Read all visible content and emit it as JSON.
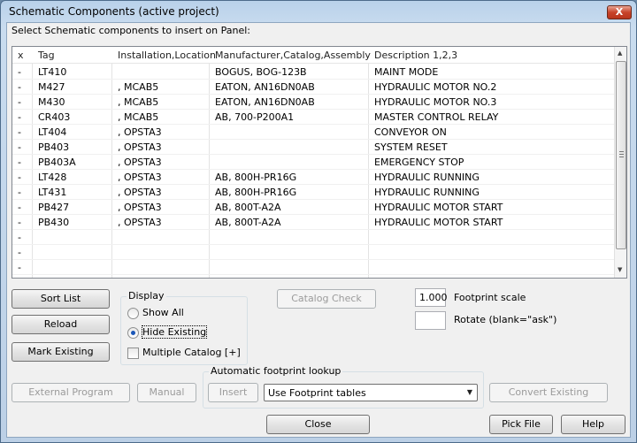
{
  "window": {
    "title": "Schematic Components (active project)",
    "close_glyph": "X"
  },
  "prompt": "Select Schematic components to insert on Panel:",
  "table": {
    "headers": [
      "x",
      "Tag",
      "Installation,Location",
      "Manufacturer,Catalog,Assembly",
      "Description 1,2,3"
    ],
    "rows": [
      {
        "x": "-",
        "tag": "LT410",
        "loc": "",
        "mfr": "BOGUS, BOG-123B",
        "desc": "MAINT MODE"
      },
      {
        "x": "-",
        "tag": "M427",
        "loc": ", MCAB5",
        "mfr": "EATON, AN16DN0AB",
        "desc": "HYDRAULIC MOTOR NO.2"
      },
      {
        "x": "-",
        "tag": "M430",
        "loc": ", MCAB5",
        "mfr": "EATON, AN16DN0AB",
        "desc": "HYDRAULIC MOTOR NO.3"
      },
      {
        "x": "-",
        "tag": "CR403",
        "loc": ", MCAB5",
        "mfr": "AB, 700-P200A1",
        "desc": "MASTER CONTROL RELAY"
      },
      {
        "x": "-",
        "tag": "LT404",
        "loc": ", OPSTA3",
        "mfr": "",
        "desc": "CONVEYOR ON"
      },
      {
        "x": "-",
        "tag": "PB403",
        "loc": ", OPSTA3",
        "mfr": "",
        "desc": "SYSTEM RESET"
      },
      {
        "x": "-",
        "tag": "PB403A",
        "loc": ", OPSTA3",
        "mfr": "",
        "desc": "EMERGENCY STOP"
      },
      {
        "x": "-",
        "tag": "LT428",
        "loc": ", OPSTA3",
        "mfr": "AB, 800H-PR16G",
        "desc": "HYDRAULIC RUNNING"
      },
      {
        "x": "-",
        "tag": "LT431",
        "loc": ", OPSTA3",
        "mfr": "AB, 800H-PR16G",
        "desc": "HYDRAULIC RUNNING"
      },
      {
        "x": "-",
        "tag": "PB427",
        "loc": ", OPSTA3",
        "mfr": "AB, 800T-A2A",
        "desc": "HYDRAULIC MOTOR START"
      },
      {
        "x": "-",
        "tag": "PB430",
        "loc": ", OPSTA3",
        "mfr": "AB, 800T-A2A",
        "desc": "HYDRAULIC MOTOR START"
      },
      {
        "x": "-",
        "tag": "",
        "loc": "",
        "mfr": "",
        "desc": ""
      },
      {
        "x": "-",
        "tag": "",
        "loc": "",
        "mfr": "",
        "desc": ""
      },
      {
        "x": "-",
        "tag": "",
        "loc": "",
        "mfr": "",
        "desc": ""
      }
    ]
  },
  "buttons": {
    "sort_list": "Sort List",
    "reload": "Reload",
    "mark_existing": "Mark Existing",
    "catalog_check": "Catalog Check",
    "external_program": "External Program",
    "manual": "Manual",
    "insert": "Insert",
    "convert_existing": "Convert Existing",
    "close": "Close",
    "pick_file": "Pick File",
    "help": "Help"
  },
  "display": {
    "label": "Display",
    "show_all": "Show All",
    "hide_existing": "Hide Existing",
    "multiple_catalog": "Multiple Catalog [+]",
    "selected": "hide_existing"
  },
  "footprint": {
    "scale_value": "1.000",
    "scale_label": "Footprint scale",
    "rotate_value": "",
    "rotate_label": "Rotate (blank=\"ask\")"
  },
  "lookup": {
    "label": "Automatic footprint lookup",
    "combo_value": "Use Footprint tables"
  },
  "icons": {
    "scroll_up": "scroll-up-icon",
    "scroll_down": "scroll-down-icon",
    "combo_arrow": "chevron-down-icon"
  },
  "colors": {
    "title_bar": "#c9dcef",
    "close_button": "#c8442a",
    "radio_dot": "#1b57b8"
  }
}
